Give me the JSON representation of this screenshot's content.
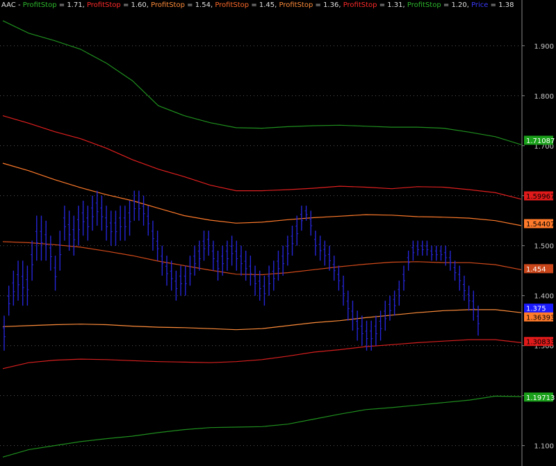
{
  "legend": {
    "symbol": "AAC",
    "separator": " - ",
    "items": [
      {
        "name": "ProfitStop",
        "value": "1.71",
        "color": "#2db82d"
      },
      {
        "name": "ProfitStop",
        "value": "1.60",
        "color": "#ff2a2a"
      },
      {
        "name": "ProfitStop",
        "value": "1.54",
        "color": "#ff8c3a"
      },
      {
        "name": "ProfitStop",
        "value": "1.45",
        "color": "#ff6a2a"
      },
      {
        "name": "ProfitStop",
        "value": "1.36",
        "color": "#ff8c3a"
      },
      {
        "name": "ProfitStop",
        "value": "1.31",
        "color": "#ff2a2a"
      },
      {
        "name": "ProfitStop",
        "value": "1.20",
        "color": "#2db82d"
      },
      {
        "name": "Price",
        "value": "1.38",
        "color": "#3a3aff"
      }
    ]
  },
  "chart_data": {
    "type": "line",
    "ylim": [
      1.062,
      1.972
    ],
    "yticks": [
      1.1,
      1.2,
      1.3,
      1.4,
      1.5,
      1.6,
      1.7,
      1.8,
      1.9
    ],
    "ytick_labels": [
      "1.100",
      "",
      "1.300",
      "1.400",
      "1.500",
      "",
      "1.700",
      "1.800",
      "1.900"
    ],
    "grid": true,
    "colors": {
      "background": "#000000",
      "axis": "#8a8a8a",
      "tick_text": "#c8c8c8",
      "grid": "#5a5a5a"
    },
    "series": [
      {
        "color": "#1f8f1f",
        "x": [
          0,
          0.05,
          0.1,
          0.15,
          0.2,
          0.25,
          0.3,
          0.35,
          0.4,
          0.45,
          0.5,
          0.55,
          0.6,
          0.65,
          0.7,
          0.75,
          0.8,
          0.85,
          0.9,
          0.95,
          1
        ],
        "y": [
          1.95,
          1.925,
          1.91,
          1.893,
          1.865,
          1.83,
          1.78,
          1.76,
          1.746,
          1.736,
          1.735,
          1.738,
          1.74,
          1.741,
          1.739,
          1.737,
          1.737,
          1.735,
          1.727,
          1.718,
          1.702
        ]
      },
      {
        "color": "#e01f1f",
        "x": [
          0,
          0.05,
          0.1,
          0.15,
          0.2,
          0.25,
          0.3,
          0.35,
          0.4,
          0.45,
          0.5,
          0.55,
          0.6,
          0.65,
          0.7,
          0.75,
          0.8,
          0.85,
          0.9,
          0.95,
          1
        ],
        "y": [
          1.76,
          1.745,
          1.728,
          1.714,
          1.695,
          1.672,
          1.653,
          1.638,
          1.621,
          1.61,
          1.61,
          1.612,
          1.615,
          1.619,
          1.617,
          1.614,
          1.618,
          1.617,
          1.612,
          1.606,
          1.593
        ]
      },
      {
        "color": "#ff7a2a",
        "x": [
          0,
          0.05,
          0.1,
          0.15,
          0.2,
          0.25,
          0.3,
          0.35,
          0.4,
          0.45,
          0.5,
          0.55,
          0.6,
          0.65,
          0.7,
          0.75,
          0.8,
          0.85,
          0.9,
          0.95,
          1
        ],
        "y": [
          1.665,
          1.65,
          1.632,
          1.616,
          1.602,
          1.59,
          1.575,
          1.56,
          1.551,
          1.545,
          1.547,
          1.552,
          1.556,
          1.559,
          1.562,
          1.561,
          1.558,
          1.557,
          1.555,
          1.55,
          1.54
        ]
      },
      {
        "color": "#d24a1a",
        "x": [
          0,
          0.05,
          0.1,
          0.15,
          0.2,
          0.25,
          0.3,
          0.35,
          0.4,
          0.45,
          0.5,
          0.55,
          0.6,
          0.65,
          0.7,
          0.75,
          0.8,
          0.85,
          0.9,
          0.95,
          1
        ],
        "y": [
          1.508,
          1.506,
          1.502,
          1.497,
          1.489,
          1.48,
          1.469,
          1.46,
          1.451,
          1.443,
          1.442,
          1.446,
          1.452,
          1.458,
          1.463,
          1.467,
          1.468,
          1.466,
          1.466,
          1.462,
          1.452
        ]
      },
      {
        "color": "#ff8c3a",
        "x": [
          0,
          0.05,
          0.1,
          0.15,
          0.2,
          0.25,
          0.3,
          0.35,
          0.4,
          0.45,
          0.5,
          0.55,
          0.6,
          0.65,
          0.7,
          0.75,
          0.8,
          0.85,
          0.9,
          0.95,
          1
        ],
        "y": [
          1.338,
          1.34,
          1.342,
          1.343,
          1.342,
          1.339,
          1.337,
          1.336,
          1.334,
          1.332,
          1.334,
          1.34,
          1.346,
          1.35,
          1.356,
          1.361,
          1.366,
          1.37,
          1.372,
          1.372,
          1.366
        ]
      },
      {
        "color": "#d81f1f",
        "x": [
          0,
          0.05,
          0.1,
          0.15,
          0.2,
          0.25,
          0.3,
          0.35,
          0.4,
          0.45,
          0.5,
          0.55,
          0.6,
          0.65,
          0.7,
          0.75,
          0.8,
          0.85,
          0.9,
          0.95,
          1
        ],
        "y": [
          1.254,
          1.266,
          1.271,
          1.273,
          1.272,
          1.27,
          1.268,
          1.267,
          1.266,
          1.268,
          1.272,
          1.279,
          1.287,
          1.292,
          1.298,
          1.302,
          1.306,
          1.309,
          1.312,
          1.312,
          1.306
        ]
      },
      {
        "color": "#1f8f1f",
        "x": [
          0,
          0.05,
          0.1,
          0.15,
          0.2,
          0.25,
          0.3,
          0.35,
          0.4,
          0.45,
          0.5,
          0.55,
          0.6,
          0.65,
          0.7,
          0.75,
          0.8,
          0.85,
          0.9,
          0.95,
          1
        ],
        "y": [
          1.077,
          1.092,
          1.1,
          1.108,
          1.114,
          1.119,
          1.126,
          1.132,
          1.136,
          1.137,
          1.138,
          1.143,
          1.153,
          1.163,
          1.172,
          1.176,
          1.181,
          1.186,
          1.191,
          1.199,
          1.198
        ]
      }
    ],
    "price": {
      "color": "#2626d8",
      "low": [
        1.29,
        1.36,
        1.38,
        1.39,
        1.38,
        1.38,
        1.43,
        1.47,
        1.47,
        1.47,
        1.45,
        1.41,
        1.45,
        1.51,
        1.49,
        1.48,
        1.5,
        1.52,
        1.51,
        1.53,
        1.54,
        1.53,
        1.51,
        1.5,
        1.5,
        1.51,
        1.51,
        1.52,
        1.55,
        1.55,
        1.54,
        1.52,
        1.49,
        1.47,
        1.44,
        1.42,
        1.41,
        1.39,
        1.4,
        1.4,
        1.42,
        1.44,
        1.45,
        1.47,
        1.48,
        1.45,
        1.43,
        1.44,
        1.45,
        1.46,
        1.45,
        1.44,
        1.43,
        1.42,
        1.4,
        1.39,
        1.38,
        1.4,
        1.41,
        1.43,
        1.44,
        1.46,
        1.48,
        1.5,
        1.53,
        1.55,
        1.52,
        1.48,
        1.47,
        1.46,
        1.45,
        1.43,
        1.41,
        1.38,
        1.35,
        1.33,
        1.31,
        1.3,
        1.29,
        1.29,
        1.3,
        1.31,
        1.33,
        1.35,
        1.36,
        1.38,
        1.41,
        1.45,
        1.47,
        1.48,
        1.48,
        1.48,
        1.47,
        1.47,
        1.47,
        1.46,
        1.45,
        1.43,
        1.41,
        1.39,
        1.37,
        1.35,
        1.32
      ],
      "high": [
        1.36,
        1.42,
        1.45,
        1.47,
        1.47,
        1.46,
        1.51,
        1.56,
        1.56,
        1.55,
        1.52,
        1.48,
        1.53,
        1.58,
        1.57,
        1.56,
        1.58,
        1.59,
        1.58,
        1.6,
        1.61,
        1.6,
        1.58,
        1.57,
        1.57,
        1.58,
        1.58,
        1.59,
        1.61,
        1.61,
        1.6,
        1.58,
        1.55,
        1.53,
        1.5,
        1.48,
        1.47,
        1.45,
        1.46,
        1.46,
        1.48,
        1.5,
        1.51,
        1.53,
        1.53,
        1.51,
        1.49,
        1.5,
        1.51,
        1.52,
        1.51,
        1.5,
        1.49,
        1.48,
        1.46,
        1.45,
        1.44,
        1.46,
        1.47,
        1.49,
        1.5,
        1.52,
        1.54,
        1.56,
        1.58,
        1.58,
        1.57,
        1.53,
        1.52,
        1.51,
        1.5,
        1.48,
        1.46,
        1.44,
        1.41,
        1.39,
        1.37,
        1.36,
        1.35,
        1.35,
        1.36,
        1.37,
        1.39,
        1.4,
        1.41,
        1.43,
        1.46,
        1.49,
        1.51,
        1.51,
        1.51,
        1.51,
        1.5,
        1.5,
        1.5,
        1.5,
        1.49,
        1.47,
        1.46,
        1.44,
        1.42,
        1.41,
        1.38
      ]
    },
    "value_tags": [
      {
        "value": 1.71087,
        "label": "1.71087",
        "bg": "#1aa01a",
        "fg": "#ffffff"
      },
      {
        "value": 1.5996,
        "label": "1.59967",
        "bg": "#e01a1a",
        "fg": "#000000"
      },
      {
        "value": 1.5441,
        "label": "1.54407",
        "bg": "#ff7a2a",
        "fg": "#000000"
      },
      {
        "value": 1.454,
        "label": "1.454",
        "bg": "#c8461a",
        "fg": "#ffffff"
      },
      {
        "value": 1.375,
        "label": "1.375",
        "bg": "#1a1aff",
        "fg": "#ffffff"
      },
      {
        "value": 1.3574,
        "label": "1.36393",
        "bg": "#ff7a2a",
        "fg": "#000000"
      },
      {
        "value": 1.3083,
        "label": "1.30833",
        "bg": "#e01a1a",
        "fg": "#000000"
      },
      {
        "value": 1.1971,
        "label": "1.19713",
        "bg": "#1aa01a",
        "fg": "#ffffff"
      }
    ]
  }
}
